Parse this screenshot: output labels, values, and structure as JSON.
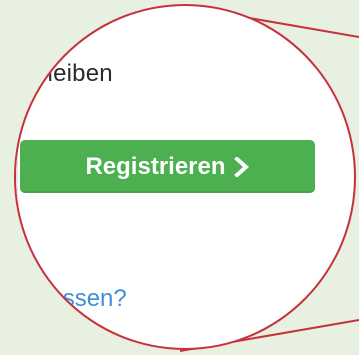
{
  "colors": {
    "background": "#e8f0e1",
    "magnifier_border": "#c6323c",
    "button": "#4caf50",
    "link": "#3f8fd8"
  },
  "content": {
    "stay_label": "bleiben",
    "register_button_label": "Registrieren",
    "register_button_icon": "chevron-right-icon",
    "forgot_link": "rgessen?"
  }
}
